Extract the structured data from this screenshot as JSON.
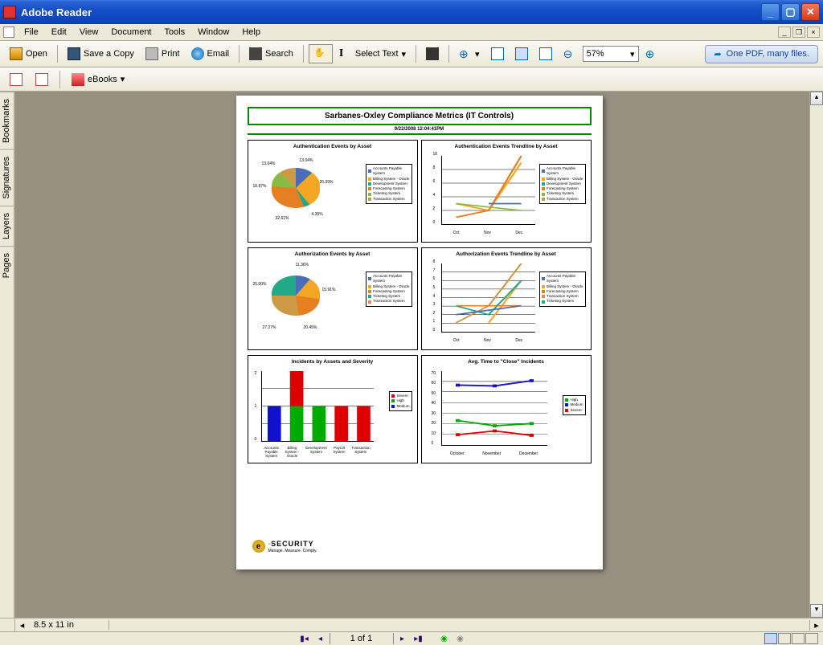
{
  "window": {
    "title": "Adobe Reader"
  },
  "menu": {
    "file": "File",
    "edit": "Edit",
    "view": "View",
    "document": "Document",
    "tools": "Tools",
    "window": "Window",
    "help": "Help"
  },
  "toolbar": {
    "open": "Open",
    "save_copy": "Save a Copy",
    "print": "Print",
    "email": "Email",
    "search": "Search",
    "select_text": "Select Text",
    "zoom_value": "57%",
    "ebooks": "eBooks",
    "help_text": "One PDF, many files."
  },
  "sidebar": {
    "bookmarks": "Bookmarks",
    "signatures": "Signatures",
    "layers": "Layers",
    "pages": "Pages"
  },
  "status": {
    "page_size": "8.5 x 11 in",
    "page_num": "1 of 1"
  },
  "report": {
    "title": "Sarbanes-Oxley Compliance Metrics (IT Controls)",
    "date": "9/22/2008  12:04:41PM",
    "logo_text": "SECURITY",
    "logo_sub": "Manage. Measure. Comply.",
    "charts": {
      "c1": "Authentication Events by Asset",
      "c2": "Authentication Events Trendline by Asset",
      "c3": "Authorization Events by Asset",
      "c4": "Authorization Events Trendline by Asset",
      "c5": "Incidents by Assets and Severity",
      "c6": "Avg. Time to \"Close\" Incidents"
    }
  },
  "chart_data": [
    {
      "type": "pie",
      "title": "Authentication Events by Asset",
      "series": [
        {
          "name": "Accounts Payable System",
          "value": 13.04
        },
        {
          "name": "Billing System - Oracle",
          "value": 26.09
        },
        {
          "name": "Development System",
          "value": 4.35
        },
        {
          "name": "Forecasting System",
          "value": 32.61
        },
        {
          "name": "Ticketing System",
          "value": 10.87
        },
        {
          "name": "Transaction System",
          "value": 13.04
        }
      ]
    },
    {
      "type": "line",
      "title": "Authentication Events Trendline by Asset",
      "categories": [
        "Oct",
        "Nov",
        "Dec"
      ],
      "ylim": [
        0,
        10
      ],
      "series": [
        {
          "name": "Accounts Payable System",
          "values": [
            null,
            3,
            3
          ]
        },
        {
          "name": "Billing System - Oracle",
          "values": [
            1,
            2,
            9
          ]
        },
        {
          "name": "Development System",
          "values": [
            null,
            2,
            null
          ]
        },
        {
          "name": "Forecasting System",
          "values": [
            3,
            2,
            10
          ]
        },
        {
          "name": "Ticketing System",
          "values": [
            3,
            null,
            2
          ]
        },
        {
          "name": "Transaction System",
          "values": [
            null,
            2,
            4
          ]
        }
      ]
    },
    {
      "type": "pie",
      "title": "Authorization Events by Asset",
      "series": [
        {
          "name": "Accounts Payable System",
          "value": 11.36
        },
        {
          "name": "Billing System - Oracle",
          "value": 15.91
        },
        {
          "name": "Forecasting System",
          "value": 20.45
        },
        {
          "name": "Transaction System",
          "value": 27.27
        },
        {
          "name": "Ticketing System",
          "value": 25.0
        }
      ]
    },
    {
      "type": "line",
      "title": "Authorization Events Trendline by Asset",
      "categories": [
        "Oct",
        "Nov",
        "Dec"
      ],
      "ylim": [
        0,
        8
      ],
      "series": [
        {
          "name": "Accounts Payable System",
          "values": [
            2,
            null,
            3
          ]
        },
        {
          "name": "Billing System - Oracle",
          "values": [
            null,
            1,
            6
          ]
        },
        {
          "name": "Forecasting System",
          "values": [
            3,
            3,
            3
          ]
        },
        {
          "name": "Transaction System",
          "values": [
            1,
            3,
            8
          ]
        },
        {
          "name": "Ticketing System",
          "values": [
            3,
            2,
            6
          ]
        }
      ]
    },
    {
      "type": "bar",
      "title": "Incidents by Assets and Severity",
      "categories": [
        "Accounts Payable System",
        "Billing System - Oracle",
        "Development System",
        "Payroll System",
        "Transaction System"
      ],
      "ylim": [
        0,
        2
      ],
      "series": [
        {
          "name": "Severe",
          "color": "#d00"
        },
        {
          "name": "High",
          "color": "#0a0"
        },
        {
          "name": "Medium",
          "color": "#11c"
        }
      ],
      "stacks": [
        {
          "Medium": 1,
          "Severe": 0,
          "High": 0
        },
        {
          "High": 1,
          "Severe": 1
        },
        {
          "High": 1
        },
        {
          "Severe": 1
        },
        {
          "Severe": 1
        }
      ]
    },
    {
      "type": "line",
      "title": "Avg. Time to \"Close\" Incidents",
      "categories": [
        "October",
        "November",
        "December"
      ],
      "ylim": [
        0,
        70
      ],
      "series": [
        {
          "name": "High",
          "values": [
            23,
            18,
            20
          ],
          "color": "#0a0"
        },
        {
          "name": "Medium",
          "values": [
            57,
            56,
            61
          ],
          "color": "#11c"
        },
        {
          "name": "Severe",
          "values": [
            10,
            13,
            9
          ],
          "color": "#d00"
        }
      ]
    }
  ]
}
